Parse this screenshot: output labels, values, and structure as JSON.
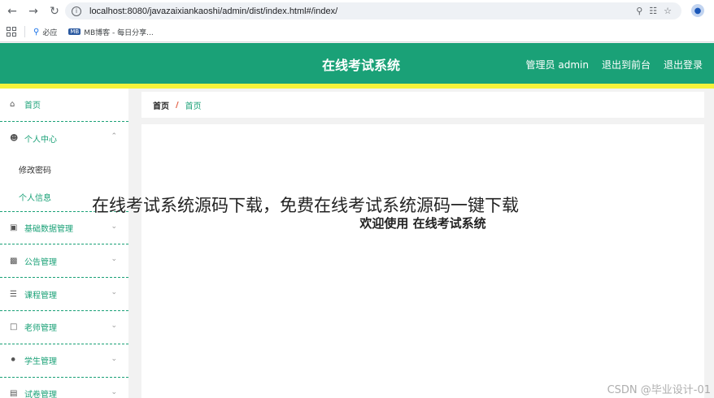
{
  "browser": {
    "url": "localhost:8080/javazaixiankaoshi/admin/dist/index.html#/index/",
    "bookmarks": [
      {
        "label": "必应",
        "icon": "search-icon"
      },
      {
        "label": "MB博客 - 每日分享...",
        "icon": "mb-logo-icon"
      }
    ],
    "profile_icon": "person-icon"
  },
  "header": {
    "title": "在线考试系统",
    "user": "管理员 admin",
    "back_front": "退出到前台",
    "logout": "退出登录",
    "color": "#1aa177",
    "stripe_color": "#f5f23a"
  },
  "sidebar": {
    "items": [
      {
        "label": "首页",
        "icon": "home-icon",
        "has_children": false
      },
      {
        "label": "个人中心",
        "icon": "user-icon",
        "has_children": true,
        "expanded": true,
        "children": [
          {
            "label": "修改密码",
            "active": false
          },
          {
            "label": "个人信息",
            "active": true
          }
        ]
      },
      {
        "label": "基础数据管理",
        "icon": "video-icon",
        "has_children": true
      },
      {
        "label": "公告管理",
        "icon": "suitcase-icon",
        "has_children": true
      },
      {
        "label": "课程管理",
        "icon": "sliders-icon",
        "has_children": true
      },
      {
        "label": "老师管理",
        "icon": "chat-icon",
        "has_children": true
      },
      {
        "label": "学生管理",
        "icon": "microphone-icon",
        "has_children": true
      },
      {
        "label": "试卷管理",
        "icon": "document-icon",
        "has_children": true
      }
    ]
  },
  "breadcrumb": {
    "home": "首页",
    "separator": "/",
    "current": "首页"
  },
  "main": {
    "welcome": "欢迎使用 在线考试系统"
  },
  "overlay": {
    "caption": "在线考试系统源码下载，免费在线考试系统源码一键下载",
    "watermark": "CSDN @毕业设计-01"
  }
}
